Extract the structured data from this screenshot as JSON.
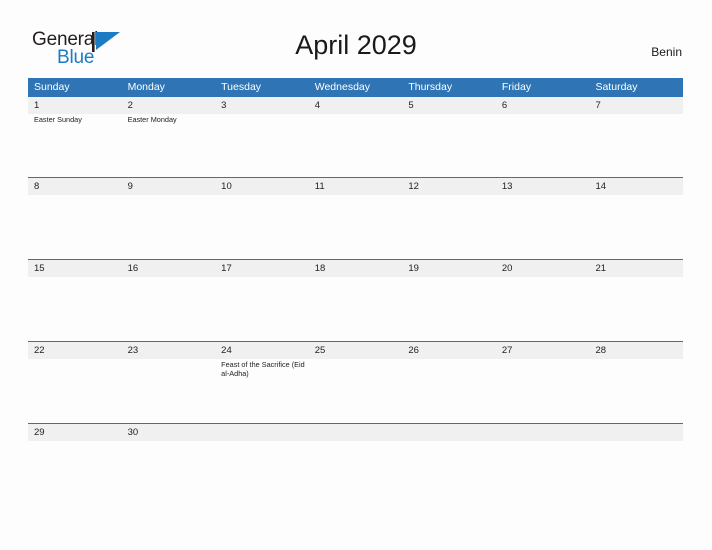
{
  "brand": {
    "word_one": "General",
    "word_two": "Blue",
    "mark": "triangle-flag-icon",
    "accent_color": "#1c7bc3"
  },
  "header": {
    "title": "April 2029",
    "locale": "Benin"
  },
  "theme": {
    "header_blue": "#2f75b5",
    "row_strip_gray": "#f0f0f0",
    "page_background": "#fdfdfd",
    "text_color": "#222222"
  },
  "calendar": {
    "weekdays": [
      "Sunday",
      "Monday",
      "Tuesday",
      "Wednesday",
      "Thursday",
      "Friday",
      "Saturday"
    ],
    "weeks": [
      [
        {
          "date": "1",
          "events": [
            "Easter Sunday"
          ]
        },
        {
          "date": "2",
          "events": [
            "Easter Monday"
          ]
        },
        {
          "date": "3",
          "events": []
        },
        {
          "date": "4",
          "events": []
        },
        {
          "date": "5",
          "events": []
        },
        {
          "date": "6",
          "events": []
        },
        {
          "date": "7",
          "events": []
        }
      ],
      [
        {
          "date": "8",
          "events": []
        },
        {
          "date": "9",
          "events": []
        },
        {
          "date": "10",
          "events": []
        },
        {
          "date": "11",
          "events": []
        },
        {
          "date": "12",
          "events": []
        },
        {
          "date": "13",
          "events": []
        },
        {
          "date": "14",
          "events": []
        }
      ],
      [
        {
          "date": "15",
          "events": []
        },
        {
          "date": "16",
          "events": []
        },
        {
          "date": "17",
          "events": []
        },
        {
          "date": "18",
          "events": []
        },
        {
          "date": "19",
          "events": []
        },
        {
          "date": "20",
          "events": []
        },
        {
          "date": "21",
          "events": []
        }
      ],
      [
        {
          "date": "22",
          "events": []
        },
        {
          "date": "23",
          "events": []
        },
        {
          "date": "24",
          "events": [
            "Feast of the Sacrifice (Eid al-Adha)"
          ]
        },
        {
          "date": "25",
          "events": []
        },
        {
          "date": "26",
          "events": []
        },
        {
          "date": "27",
          "events": []
        },
        {
          "date": "28",
          "events": []
        }
      ],
      [
        {
          "date": "29",
          "events": []
        },
        {
          "date": "30",
          "events": []
        },
        {
          "date": "",
          "events": []
        },
        {
          "date": "",
          "events": []
        },
        {
          "date": "",
          "events": []
        },
        {
          "date": "",
          "events": []
        },
        {
          "date": "",
          "events": []
        }
      ]
    ]
  }
}
